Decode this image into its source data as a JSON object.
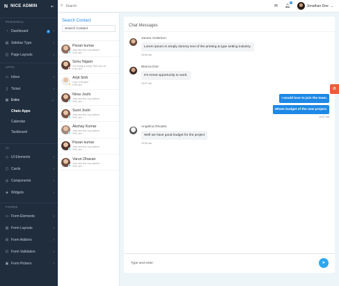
{
  "brand": {
    "logo": "N",
    "name": "NICE ADMIN"
  },
  "sidebar": {
    "sections": [
      {
        "label": "PERSONAL",
        "items": [
          {
            "label": "Dashboard",
            "icon": "gauge-icon",
            "badge": "4"
          },
          {
            "label": "Sidebar Type",
            "icon": "sidebar-icon"
          },
          {
            "label": "Page Layouts",
            "icon": "layout-icon"
          }
        ]
      },
      {
        "label": "APPS",
        "items": [
          {
            "label": "Inbox",
            "icon": "inbox-icon"
          },
          {
            "label": "Ticket",
            "icon": "ticket-icon"
          },
          {
            "label": "Extra",
            "icon": "grid-icon"
          }
        ]
      },
      {
        "label": "UI",
        "items": [
          {
            "label": "UI Elements",
            "icon": "ui-icon"
          },
          {
            "label": "Cards",
            "icon": "card-icon"
          },
          {
            "label": "Components",
            "icon": "component-icon"
          },
          {
            "label": "Widgets",
            "icon": "widget-icon"
          }
        ]
      },
      {
        "label": "FORMS",
        "items": [
          {
            "label": "Form Elements",
            "icon": "form-icon"
          },
          {
            "label": "Form Layouts",
            "icon": "form-layout-icon"
          },
          {
            "label": "Form Addons",
            "icon": "addon-icon"
          },
          {
            "label": "Form Validation",
            "icon": "check-icon"
          },
          {
            "label": "Form Pickers",
            "icon": "picker-icon"
          }
        ]
      }
    ],
    "extra_sub": [
      "Chats Apps",
      "Calendar",
      "Taskboard"
    ]
  },
  "topbar": {
    "search_placeholder": "Search",
    "user_name": "Jonathan Doe",
    "notif_count": "5"
  },
  "contacts": {
    "title": "Search Contact",
    "search_placeholder": "Search Contact",
    "items": [
      {
        "name": "Pavan kumar",
        "status": "Just see the my admin!",
        "time": "9:30 am",
        "online": "#26c6da",
        "av": "#8d6e63"
      },
      {
        "name": "Sonu Nigam",
        "status": "I've sung a song! See you at",
        "time": "9:10 am",
        "online": "#ef5350",
        "av": "#5d4037"
      },
      {
        "name": "Arijit Sinh",
        "status": "I am a singer!",
        "time": "9:08 am",
        "online": "#ffb22b",
        "av": "#eceff1"
      },
      {
        "name": "Nirav Joshi",
        "status": "Just see the my admin!",
        "time": "9:02 am",
        "online": "#26c6da",
        "av": "#6d4c41"
      },
      {
        "name": "Sunil Joshi",
        "status": "Just see the my admin!",
        "time": "9:02 am",
        "online": "#26c6da",
        "av": "#795548"
      },
      {
        "name": "Akshay Kumar",
        "status": "Just see the my admin!",
        "time": "9:02 am",
        "online": "#26c6da",
        "av": "#a1887f"
      },
      {
        "name": "Pavan kumar",
        "status": "Just see the my admin!",
        "time": "9:02 am",
        "online": "#26c6da",
        "av": "#4e342e"
      },
      {
        "name": "Varun Dhavan",
        "status": "Just see the my admin!",
        "time": "9:02 am",
        "online": "#26c6da",
        "av": "#6d4c41"
      }
    ]
  },
  "chat": {
    "title": "Chat Messages",
    "messages": [
      {
        "name": "James Anderson",
        "text": "Lorem Ipsum is simply dummy text of the printing & type setting industry.",
        "time": "10:56 am"
      },
      {
        "name": "Bianca Doe",
        "text": "It's Great opportunity to work.",
        "time": "10:57 am"
      },
      {
        "name": "Angelina Rhodes",
        "text": "Well we have good budget for the project",
        "time": "10:59 am"
      }
    ],
    "replies": [
      {
        "text": "I would love to join the team."
      },
      {
        "text": "Whats budget of the new project."
      }
    ],
    "reply_time": "10:57 am",
    "composer_placeholder": "Type and enter"
  },
  "colors": {
    "sidebar": "#1f2d3d",
    "accent": "#1e88e5",
    "gear": "#ef5a3a"
  }
}
